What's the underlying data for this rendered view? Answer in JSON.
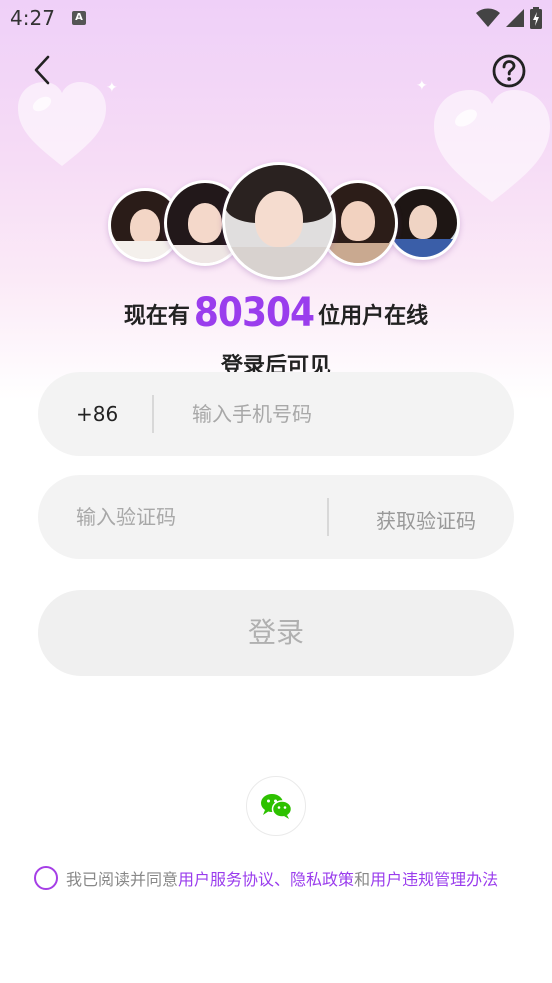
{
  "status_bar": {
    "time": "4:27",
    "notification_icon": "a-icon",
    "icons": [
      "wifi-icon",
      "signal-icon",
      "battery-icon"
    ]
  },
  "header": {
    "back_icon": "chevron-left-icon",
    "help_icon": "question-circle-icon"
  },
  "hero": {
    "online_prefix": "现在有",
    "online_count": "80304",
    "online_suffix": "位用户在线",
    "subtitle": "登录后可见"
  },
  "form": {
    "country_code": "+86",
    "phone_placeholder": "输入手机号码",
    "code_placeholder": "输入验证码",
    "get_code_label": "获取验证码",
    "login_label": "登录"
  },
  "social": {
    "wechat_icon": "wechat-icon"
  },
  "agreement": {
    "prefix": "我已阅读并同意",
    "terms_link": "用户服务协议",
    "separator": "、",
    "privacy_link": "隐私政策",
    "and": "和",
    "rules_link": "用户违规管理办法"
  },
  "colors": {
    "accent": "#9a3ded",
    "field_bg": "#f3f3f3",
    "hero_top": "#efd0f8",
    "wechat_green": "#2dc100"
  }
}
